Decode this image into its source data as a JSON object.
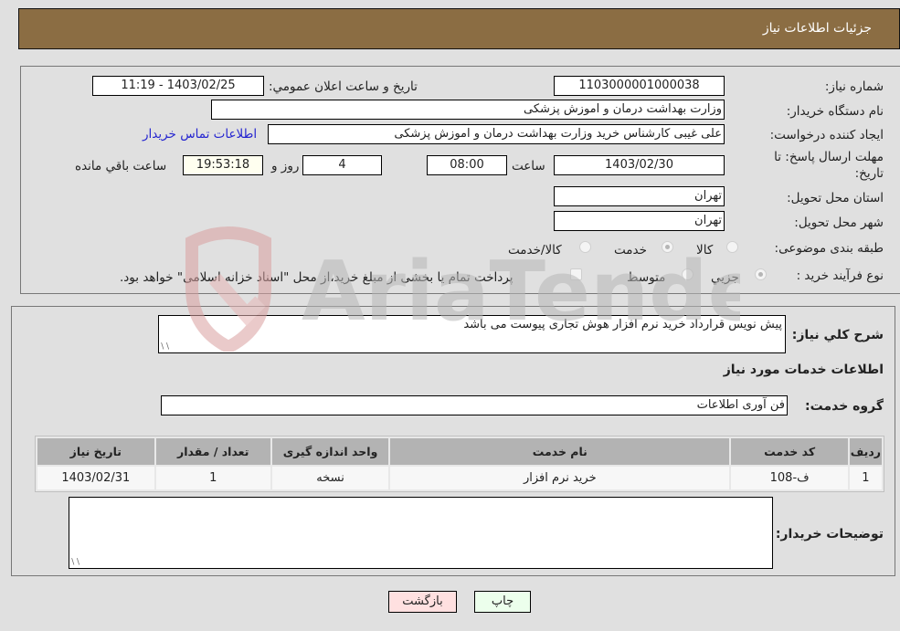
{
  "header": {
    "title": "جزئیات اطلاعات نیاز"
  },
  "fields": {
    "need_number": {
      "label": "شماره نیاز:",
      "value": "1103000001000038"
    },
    "announce_datetime": {
      "label": "تاریخ و ساعت اعلان عمومي:",
      "value": "1403/02/25 - 11:19"
    },
    "buyer_org": {
      "label": "نام دستگاه خریدار:",
      "value": "وزارت بهداشت  درمان و اموزش پزشکی"
    },
    "requester": {
      "label": "ایجاد کننده درخواست:",
      "value": "علی غیبی کارشناس خرید وزارت بهداشت  درمان و اموزش پزشکی"
    },
    "buyer_contact_link": "اطلاعات تماس خریدار",
    "deadline": {
      "label_line1": "مهلت ارسال پاسخ: تا",
      "label_line2": "تاریخ:",
      "date": "1403/02/30",
      "time_label": "ساعت",
      "time": "08:00",
      "days": "4",
      "days_label": "روز و",
      "remaining": "19:53:18",
      "remaining_label": "ساعت باقي مانده"
    },
    "province": {
      "label": "استان محل تحویل:",
      "value": "تهران"
    },
    "city": {
      "label": "شهر محل تحویل:",
      "value": "تهران"
    },
    "category": {
      "label": "طبقه بندی موضوعی:",
      "options": [
        "کالا",
        "خدمت",
        "کالا/خدمت"
      ],
      "selected": "خدمت"
    },
    "purchase_type": {
      "label": "نوع فرآیند خرید :",
      "options": [
        "جزيي",
        "متوسط"
      ],
      "selected": "جزيي",
      "treasury_note": "پرداخت تمام یا بخشی از مبلغ خرید،از محل \"اسناد خزانه اسلامی\" خواهد بود."
    }
  },
  "description": {
    "label": "شرح کلي نياز:",
    "value": "پیش نویس قرارداد خرید نرم افزار هوش تجاری پیوست می باشد"
  },
  "services_section_title": "اطلاعات خدمات مورد نیاز",
  "service_group": {
    "label": "گروه خدمت:",
    "value": "فن آوری اطلاعات"
  },
  "table": {
    "headers": [
      "ردیف",
      "کد خدمت",
      "نام خدمت",
      "واحد اندازه گیری",
      "تعداد / مقدار",
      "تاریخ نیاز"
    ],
    "rows": [
      [
        "1",
        "ف-108",
        "خرید نرم افزار",
        "نسخه",
        "1",
        "1403/02/31"
      ]
    ]
  },
  "buyer_notes": {
    "label": "توضیحات خریدار:",
    "value": ""
  },
  "buttons": {
    "print": "چاپ",
    "back": "بازگشت"
  },
  "watermark": {
    "text": "AriaTender.net"
  },
  "colors": {
    "header_bg": "#8b6d43",
    "link": "#2525d0",
    "back_btn": "#ffe0e0",
    "print_btn": "#ecffec"
  }
}
